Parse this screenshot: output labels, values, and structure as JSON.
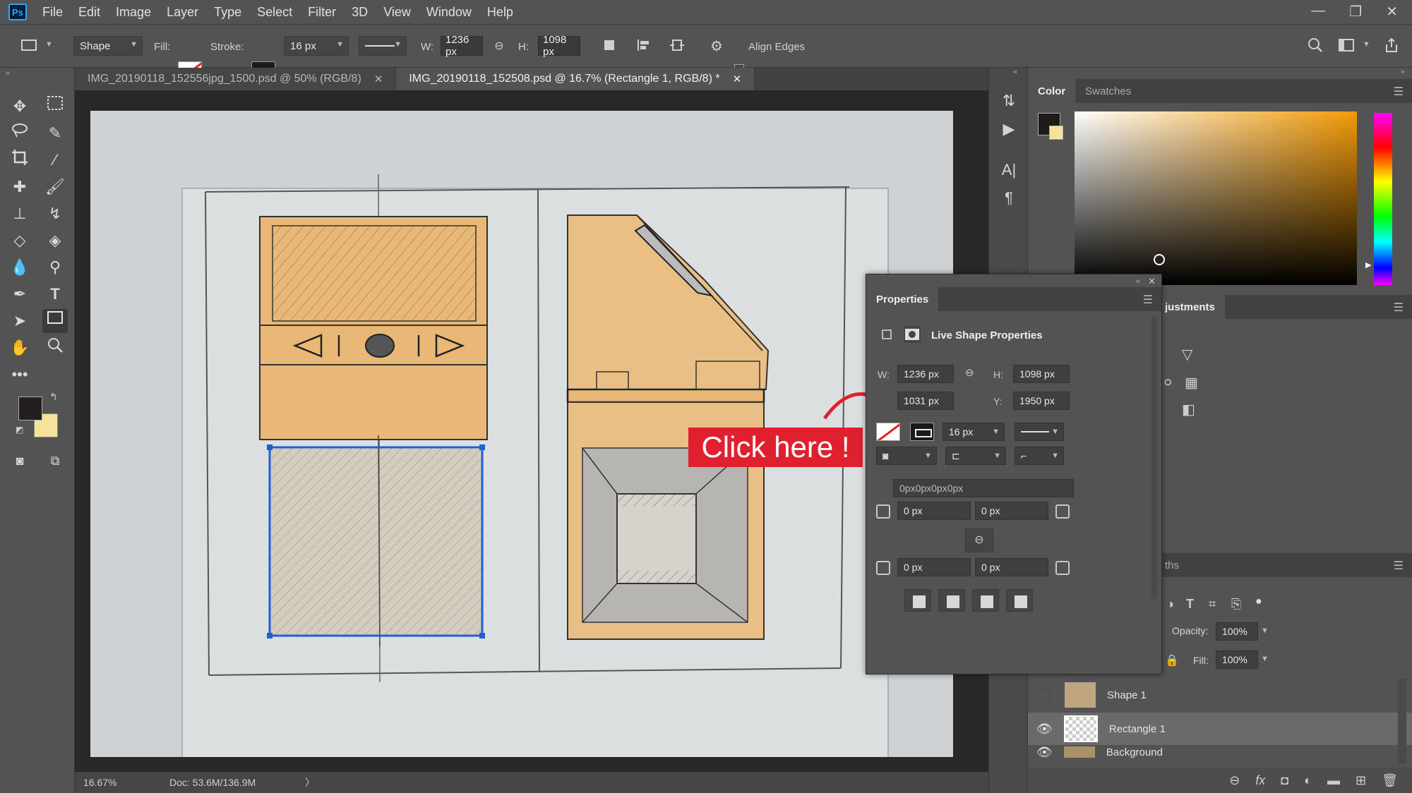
{
  "app": {
    "logo": "Ps"
  },
  "menu": [
    "File",
    "Edit",
    "Image",
    "Layer",
    "Type",
    "Select",
    "Filter",
    "3D",
    "View",
    "Window",
    "Help"
  ],
  "window_controls": [
    "—",
    "❐",
    "✕"
  ],
  "options": {
    "mode": "Shape",
    "fill_label": "Fill:",
    "stroke_label": "Stroke:",
    "stroke_size": "16 px",
    "w_label": "W:",
    "w_value": "1236 px",
    "h_label": "H:",
    "h_value": "1098 px",
    "align_edges": "Align Edges"
  },
  "tabs": [
    {
      "label": "IMG_20190118_152556jpg_1500.psd @ 50% (RGB/8)",
      "close": "✕"
    },
    {
      "label": "IMG_20190118_152508.psd @ 16.7% (Rectangle 1, RGB/8) *",
      "close": "✕"
    }
  ],
  "status": {
    "zoom": "16.67%",
    "doc": "Doc: 53.6M/136.9M",
    "arrow": "〉"
  },
  "color_panel": {
    "tab_color": "Color",
    "tab_swatches": "Swatches"
  },
  "adjustments_tab": "justments",
  "paths_tab": "ths",
  "properties": {
    "title": "Properties",
    "subtitle": "Live Shape Properties",
    "w_label": "W:",
    "w_value": "1236 px",
    "h_label": "H:",
    "h_value": "1098 px",
    "x_value": "1031 px",
    "y_label": "Y:",
    "y_value": "1950 px",
    "stroke_size": "16 px",
    "corner_all": "0px0px0px0px",
    "c1": "0 px",
    "c2": "0 px",
    "c3": "0 px",
    "c4": "0 px"
  },
  "layers": {
    "opacity_label": "Opacity:",
    "opacity": "100%",
    "fill_label": "Fill:",
    "fill": "100%",
    "items": [
      {
        "name": "Shape 1"
      },
      {
        "name": "Rectangle 1"
      },
      {
        "name": "Background"
      }
    ]
  },
  "callout": "Click here !",
  "colors": {
    "fg": "#231f20",
    "bg": "#f7e29c",
    "accent": "#e0202e",
    "selection": "#1f5fd6"
  }
}
